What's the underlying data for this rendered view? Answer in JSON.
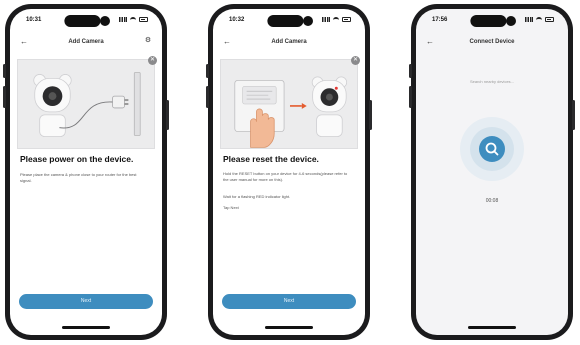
{
  "colors": {
    "accent": "#3e8dbf",
    "illustration_bg": "#ececed",
    "phone_frame": "#1b1b1d"
  },
  "screens": [
    {
      "time": "10:31",
      "title": "Add Camera",
      "back_icon": "back-arrow-icon",
      "help_icon": "help-icon",
      "heading": "Please power on the device.",
      "body": [
        "Please place the camera & phone close to your router for the best signal."
      ],
      "next_label": "Next"
    },
    {
      "time": "10:32",
      "title": "Add Camera",
      "back_icon": "back-arrow-icon",
      "heading": "Please reset the device.",
      "body": [
        "Hold the RESET button on your device for 4-6 seconds(please refer to the user manual for more on this).",
        "Wait for a flashing RED indicator light.",
        "Tap Next"
      ],
      "next_label": "Next"
    },
    {
      "time": "17:56",
      "title": "Connect Device",
      "back_icon": "back-arrow-icon",
      "searching_text": "Search nearby devices...",
      "timer": "00:08"
    }
  ]
}
